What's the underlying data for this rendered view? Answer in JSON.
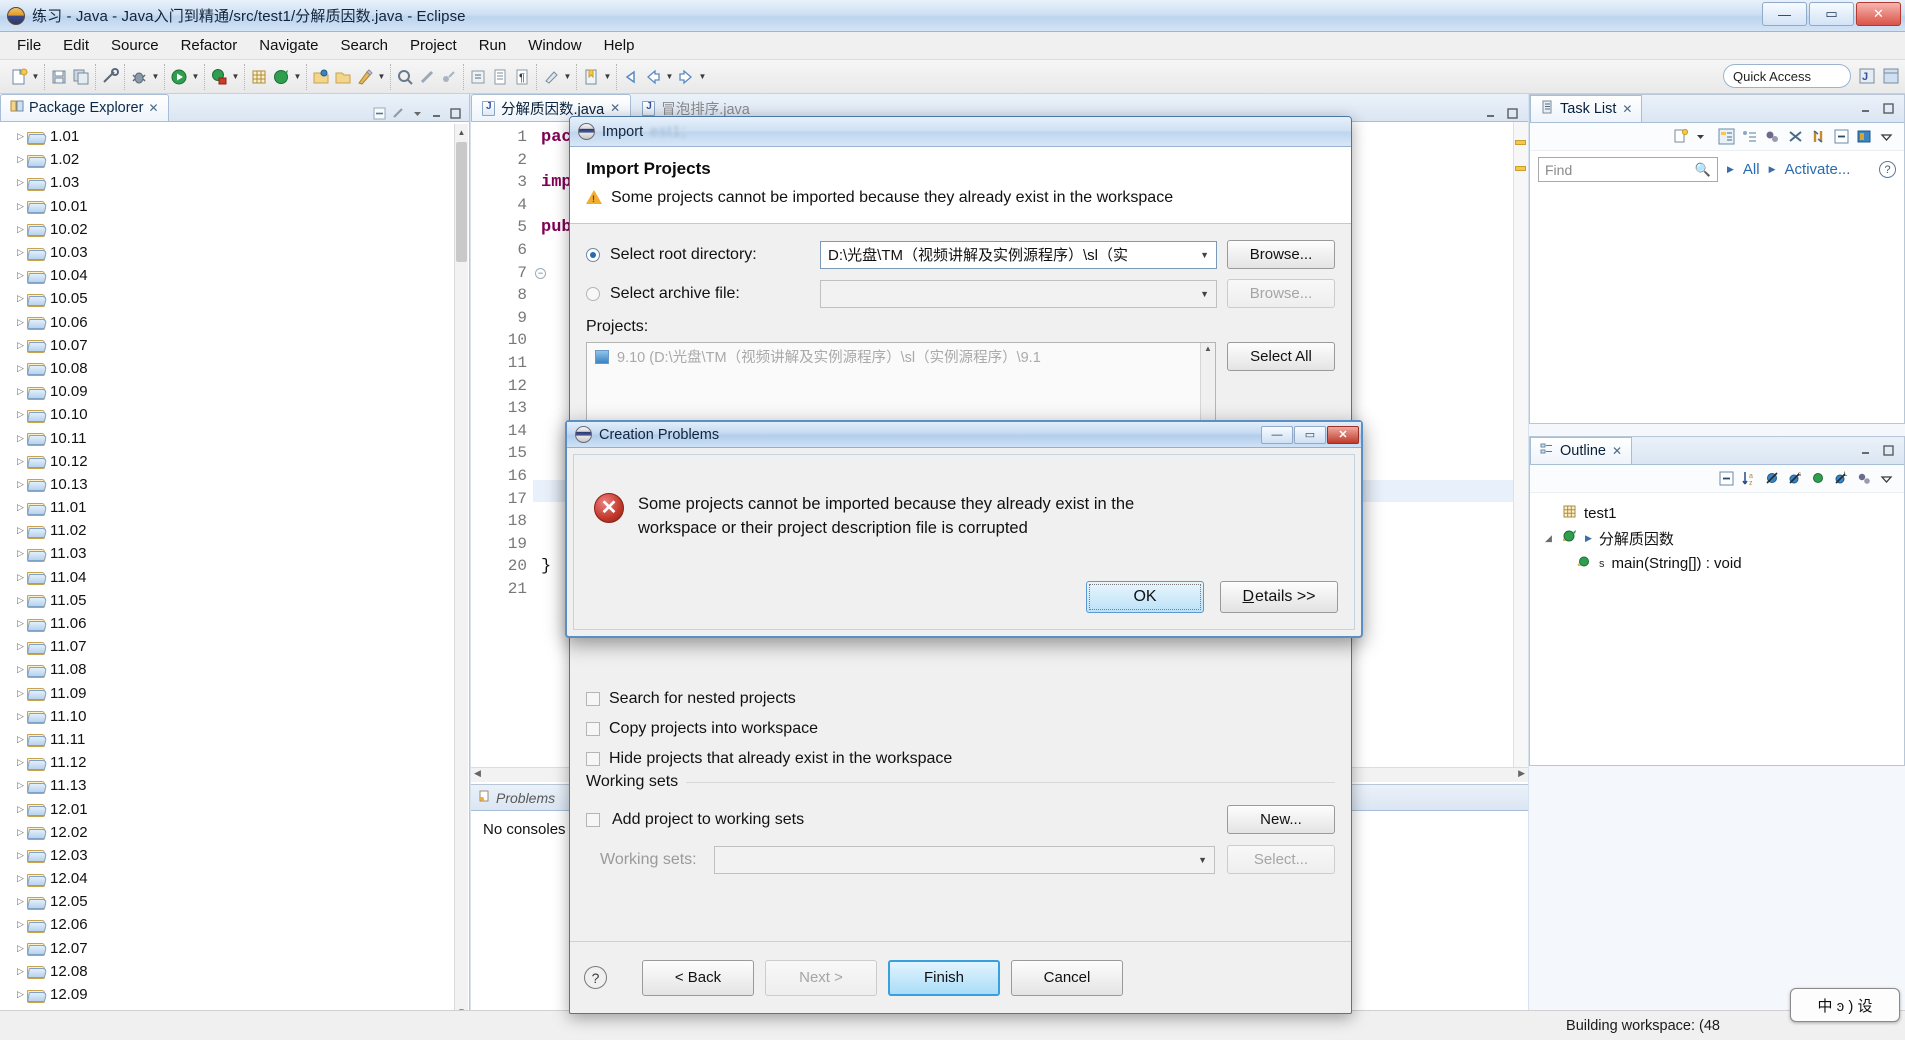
{
  "window": {
    "title": "练习 - Java - Java入门到精通/src/test1/分解质因数.java - Eclipse",
    "minimize": "—",
    "maximize": "▭",
    "close": "✕"
  },
  "menubar": {
    "items": [
      "File",
      "Edit",
      "Source",
      "Refactor",
      "Navigate",
      "Search",
      "Project",
      "Run",
      "Window",
      "Help"
    ]
  },
  "toolbar": {
    "quick_access_placeholder": "Quick Access",
    "icons": [
      "new-file-icon",
      "new-dropdown-caret",
      "save-icon",
      "save-all-icon",
      "toggle-mark-occurrences-icon",
      "debug-icon",
      "debug-caret",
      "run-icon",
      "run-caret",
      "external-tools-icon",
      "external-tools-caret",
      "new-java-project-icon",
      "new-package-icon",
      "new-package-caret",
      "open-type-icon",
      "open-folder-icon",
      "new-class-icon",
      "new-class-caret",
      "search-icon",
      "link-icon",
      "skip-icon",
      "next-annotation-icon",
      "previous-annotation-icon",
      "last-edit-icon",
      "back-icon",
      "back-caret",
      "forward-icon",
      "forward-caret"
    ]
  },
  "package_explorer": {
    "tab_label": "Package Explorer",
    "tab_close": "✕",
    "items": [
      "1.01",
      "1.02",
      "1.03",
      "10.01",
      "10.02",
      "10.03",
      "10.04",
      "10.05",
      "10.06",
      "10.07",
      "10.08",
      "10.09",
      "10.10",
      "10.11",
      "10.12",
      "10.13",
      "11.01",
      "11.02",
      "11.03",
      "11.04",
      "11.05",
      "11.06",
      "11.07",
      "11.08",
      "11.09",
      "11.10",
      "11.11",
      "11.12",
      "11.13",
      "12.01",
      "12.02",
      "12.03",
      "12.04",
      "12.05",
      "12.06",
      "12.07",
      "12.08",
      "12.09"
    ]
  },
  "editor": {
    "tabs": [
      {
        "label": "分解质因数.java",
        "active": true,
        "close": "✕"
      },
      {
        "label": "冒泡排序.java",
        "active": false,
        "close": ""
      }
    ],
    "lines": [
      {
        "n": "1",
        "text": "pac"
      },
      {
        "n": "2",
        "text": ""
      },
      {
        "n": "3",
        "text": "imp"
      },
      {
        "n": "4",
        "text": ""
      },
      {
        "n": "5",
        "text": "pub"
      },
      {
        "n": "6",
        "text": ""
      },
      {
        "n": "7",
        "text": ""
      },
      {
        "n": "8",
        "text": ""
      },
      {
        "n": "9",
        "text": ""
      },
      {
        "n": "10",
        "text": ""
      },
      {
        "n": "11",
        "text": ""
      },
      {
        "n": "12",
        "text": ""
      },
      {
        "n": "13",
        "text": ""
      },
      {
        "n": "14",
        "text": ""
      },
      {
        "n": "15",
        "text": ""
      },
      {
        "n": "16",
        "text": ""
      },
      {
        "n": "17",
        "text": ""
      },
      {
        "n": "18",
        "text": ""
      },
      {
        "n": "19",
        "text": ""
      },
      {
        "n": "20",
        "text": "}"
      },
      {
        "n": "21",
        "text": ""
      }
    ]
  },
  "bottom_view": {
    "tab_label": "Problems",
    "body_text": "No consoles"
  },
  "task_list": {
    "tab_label": "Task List",
    "tab_close": "✕",
    "find_placeholder": "Find",
    "all_label": "All",
    "activate_label": "Activate...",
    "toolbar_icons": [
      "new-task-icon",
      "new-task-caret",
      "categorized-icon",
      "flat-icon",
      "focus-icon",
      "filter-icon",
      "synchronize-icon",
      "collapse-all-icon",
      "restore-icon",
      "view-menu-caret"
    ]
  },
  "outline": {
    "tab_label": "Outline",
    "tab_close": "✕",
    "toolbar_icons": [
      "collapse-all-icon",
      "sort-icon",
      "hide-fields-icon",
      "hide-static-icon",
      "hide-nonpublic-icon",
      "hide-local-icon",
      "link-editor-icon",
      "view-menu-caret"
    ],
    "items": [
      {
        "label": "test1",
        "icon": "package-icon",
        "indent": 1
      },
      {
        "label": "分解质因数",
        "icon": "class-icon",
        "indent": 1
      },
      {
        "label": "main(String[]) : void",
        "icon": "method-icon",
        "indent": 2
      }
    ]
  },
  "status_bar": {
    "text": "Building workspace: (48"
  },
  "ime": {
    "text": "中 ͽ ) 设"
  },
  "import_dialog": {
    "window_title": "Import",
    "window_title_blurred": "est1;",
    "heading": "Import Projects",
    "warning": "Some projects cannot be imported because they already exist in the workspace",
    "root_dir_label": "Select root directory:",
    "root_dir_value": "D:\\光盘\\TM（视频讲解及实例源程序）\\sl（实",
    "archive_label": "Select archive file:",
    "archive_value": "",
    "browse_label": "Browse...",
    "browse_label_2": "Browse...",
    "projects_label": "Projects:",
    "projects": [
      "9.10 (D:\\光盘\\TM（视频讲解及实例源程序）\\sl（实例源程序）\\9.1"
    ],
    "select_all_label": "Select All",
    "checkboxes": [
      "Search for nested projects",
      "Copy projects into workspace",
      "Hide projects that already exist in the workspace"
    ],
    "working_sets_group": "Working sets",
    "add_to_working_sets": "Add project to working sets",
    "new_label": "New...",
    "working_sets_label": "Working sets:",
    "working_sets_value": "",
    "select_label": "Select...",
    "help_icon": "?",
    "back_label": "< Back",
    "next_label": "Next >",
    "finish_label": "Finish",
    "cancel_label": "Cancel"
  },
  "creation_problems_dialog": {
    "title": "Creation Problems",
    "minimize": "—",
    "maximize": "▭",
    "close": "✕",
    "message_line1": "Some projects cannot be imported because they already exist in the",
    "message_line2": "workspace or their project description file is corrupted",
    "ok_label": "OK",
    "details_label": "Details >>",
    "error_glyph": "✕"
  }
}
